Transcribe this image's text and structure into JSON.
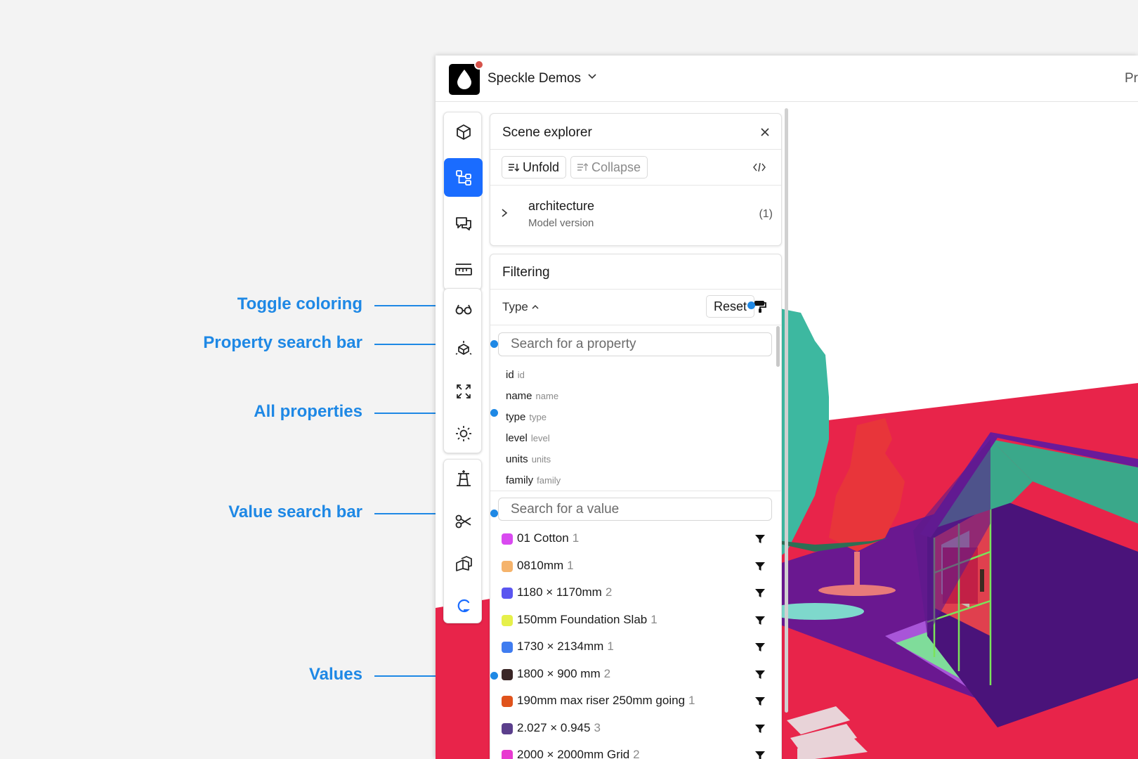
{
  "annotations": {
    "toggle_coloring": "Toggle coloring",
    "property_search_bar": "Property search bar",
    "all_properties": "All properties",
    "value_search_bar": "Value search bar",
    "values": "Values"
  },
  "topbar": {
    "workspace_name": "Speckle Demos",
    "right_text": "Pr",
    "notification_color": "#d6534b"
  },
  "rail": {
    "icons": [
      "cube-icon",
      "scene-tree-icon",
      "comments-icon",
      "measure-ruler-icon",
      "glasses-icon",
      "explode-icon",
      "fit-view-icon",
      "light-icon",
      "section-box-icon",
      "scissors-icon",
      "views-icon",
      "speckle-logo-icon"
    ],
    "active": "scene-tree-icon",
    "accent": "#1a6cff"
  },
  "scene_explorer": {
    "title": "Scene explorer",
    "unfold_label": "Unfold",
    "collapse_label": "Collapse",
    "model": {
      "name": "architecture",
      "subtitle": "Model version",
      "count": "(1)"
    }
  },
  "filtering": {
    "title": "Filtering",
    "type_label": "Type",
    "reset_label": "Reset",
    "property_search_placeholder": "Search for a property",
    "properties": [
      {
        "name": "id",
        "key": "id"
      },
      {
        "name": "name",
        "key": "name"
      },
      {
        "name": "type",
        "key": "type"
      },
      {
        "name": "level",
        "key": "level"
      },
      {
        "name": "units",
        "key": "units"
      },
      {
        "name": "family",
        "key": "family"
      }
    ],
    "value_search_placeholder": "Search for a value",
    "values": [
      {
        "label": "01 Cotton",
        "count": "1",
        "color": "#d94af0"
      },
      {
        "label": "0810mm",
        "count": "1",
        "color": "#f5b36b"
      },
      {
        "label": "1180 × 1170mm",
        "count": "2",
        "color": "#5a55f0"
      },
      {
        "label": "150mm Foundation Slab",
        "count": "1",
        "color": "#e6f04a"
      },
      {
        "label": "1730 × 2134mm",
        "count": "1",
        "color": "#3f7cf0"
      },
      {
        "label": "1800 × 900 mm",
        "count": "2",
        "color": "#3a2626"
      },
      {
        "label": "190mm max riser 250mm going",
        "count": "1",
        "color": "#e0531c"
      },
      {
        "label": "2.027 × 0.945",
        "count": "3",
        "color": "#5b3f8c"
      },
      {
        "label": "2000 × 2000mm Grid",
        "count": "2",
        "color": "#e83ad0"
      }
    ]
  },
  "colors": {
    "annotation": "#1e88e5",
    "ground": "#e8244a",
    "roof": "#3aa88a",
    "walls": "#5c1a8c",
    "tree": "#3db8a0"
  }
}
